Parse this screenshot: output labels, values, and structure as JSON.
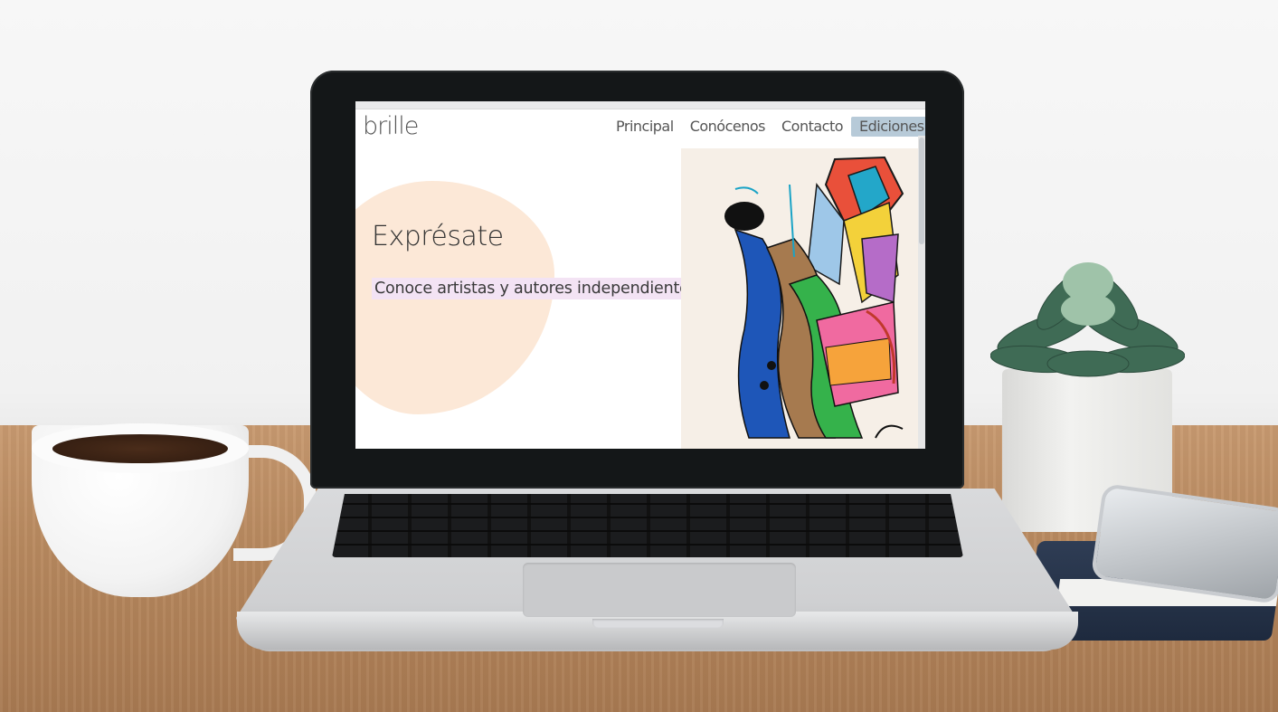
{
  "website": {
    "logo": "brille",
    "nav": [
      {
        "label": "Principal",
        "active": false
      },
      {
        "label": "Conócenos",
        "active": false
      },
      {
        "label": "Contacto",
        "active": false
      },
      {
        "label": "Ediciones",
        "active": true
      }
    ],
    "hero": {
      "title": "Exprésate",
      "subtitle": "Conoce artistas y autores independientes"
    }
  },
  "colors": {
    "nav_active_bg": "#b7cad8",
    "blob": "#fce8d7",
    "subtitle_highlight": "#f3e3f4"
  }
}
